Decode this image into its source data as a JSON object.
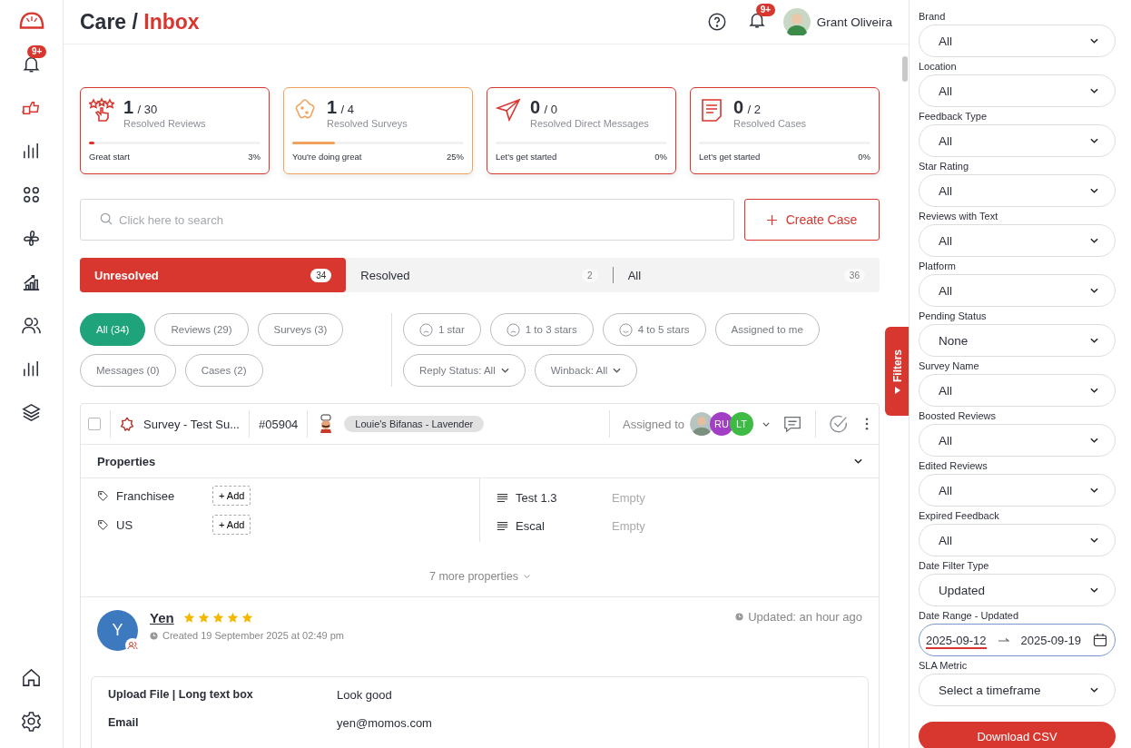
{
  "sidebar": {
    "badge": "9+",
    "items": [
      {
        "kind": "bell",
        "selected": false
      },
      {
        "kind": "feedback",
        "selected": true
      },
      {
        "kind": "chart",
        "selected": false
      },
      {
        "kind": "apps",
        "selected": false
      },
      {
        "kind": "flower",
        "selected": false
      },
      {
        "kind": "growth",
        "selected": false
      },
      {
        "kind": "people",
        "selected": false
      },
      {
        "kind": "chart",
        "selected": false
      },
      {
        "kind": "layers",
        "selected": false
      }
    ],
    "bottom_items": [
      {
        "kind": "home",
        "selected": false
      },
      {
        "kind": "settings",
        "selected": false
      }
    ]
  },
  "header": {
    "section": "Care",
    "separator": "/",
    "page": "Inbox",
    "badge": "9+",
    "user_name": "Grant Oliveira"
  },
  "stats": [
    {
      "kind": "reviews",
      "value": "1",
      "total": "/ 30",
      "label": "Resolved Reviews",
      "caption": "Great start",
      "percent": "3%",
      "level": 0.03,
      "color": "#d7372f"
    },
    {
      "kind": "surveys",
      "value": "1",
      "total": "/ 4",
      "label": "Resolved Surveys",
      "caption": "You're doing great",
      "percent": "25%",
      "level": 0.25,
      "color": "#f0a35e"
    },
    {
      "kind": "messages",
      "value": "0",
      "total": "/ 0",
      "label": "Resolved Direct Messages",
      "caption": "Let's get started",
      "percent": "0%",
      "level": 0,
      "color": "#d7372f"
    },
    {
      "kind": "cases",
      "value": "0",
      "total": "/ 2",
      "label": "Resolved Cases",
      "caption": "Let's get started",
      "percent": "0%",
      "level": 0,
      "color": "#d7372f"
    }
  ],
  "search": {
    "placeholder": "Click here to search"
  },
  "create_case": "Create Case",
  "status_tabs": [
    {
      "label": "Unresolved",
      "count": "34",
      "selected": true
    },
    {
      "label": "Resolved",
      "count": "2",
      "selected": false
    },
    {
      "label": "All",
      "count": "36",
      "selected": false
    }
  ],
  "type_filters": [
    {
      "label": "All (34)",
      "selected": true
    },
    {
      "label": "Reviews (29)",
      "selected": false
    },
    {
      "label": "Surveys (3)",
      "selected": false
    },
    {
      "label": "Messages (0)",
      "selected": false
    },
    {
      "label": "Cases (2)",
      "selected": false
    }
  ],
  "rating_filters": [
    {
      "kind": "sad",
      "label": "1 star",
      "selected": false
    },
    {
      "kind": "sad",
      "label": "1 to 3 stars",
      "selected": false
    },
    {
      "kind": "happy",
      "label": "4 to 5 stars",
      "selected": false
    },
    {
      "kind": "plain",
      "label": "Assigned to me",
      "selected": false
    },
    {
      "kind": "dropdown",
      "label": "Reply Status: All",
      "selected": false
    },
    {
      "kind": "dropdown",
      "label": "Winback: All",
      "selected": false
    }
  ],
  "item": {
    "checked": false,
    "title": "Survey - Test Su...",
    "id": "#05904",
    "location": "Louie's Bifanas - Lavender",
    "assigned_label": "Assigned to",
    "assignees": [
      {
        "kind": "photo"
      },
      {
        "kind": "initials",
        "initials": "RU",
        "color": "#a23fc4"
      },
      {
        "kind": "initials",
        "initials": "LT",
        "color": "#3dbb44"
      }
    ],
    "properties_title": "Properties",
    "tags": [
      {
        "label": "Franchisee",
        "action": "+ Add"
      },
      {
        "label": "US",
        "action": "+ Add"
      }
    ],
    "fields": [
      {
        "label": "Test 1.3",
        "value": "Empty"
      },
      {
        "label": "Escal",
        "value": "Empty"
      }
    ],
    "more": "7 more properties",
    "review": {
      "avatar": "Y",
      "name": "Yen",
      "stars": 5,
      "created": "Created 19 September 2025 at 02:49 pm",
      "updated": "Updated: an hour ago",
      "answers": [
        {
          "question": "Upload File | Long text box",
          "answer": "Look good"
        },
        {
          "question": "Email",
          "answer": "yen@momos.com"
        }
      ]
    }
  },
  "filters": {
    "tab": "Filters",
    "fields": [
      {
        "kind": "select",
        "label": "Brand",
        "value": "All"
      },
      {
        "kind": "select",
        "label": "Location",
        "value": "All"
      },
      {
        "kind": "select",
        "label": "Feedback Type",
        "value": "All"
      },
      {
        "kind": "select",
        "label": "Star Rating",
        "value": "All"
      },
      {
        "kind": "select",
        "label": "Reviews with Text",
        "value": "All"
      },
      {
        "kind": "select",
        "label": "Platform",
        "value": "All"
      },
      {
        "kind": "select",
        "label": "Pending Status",
        "value": "None"
      },
      {
        "kind": "select",
        "label": "Survey Name",
        "value": "All"
      },
      {
        "kind": "select",
        "label": "Boosted Reviews",
        "value": "All"
      },
      {
        "kind": "select",
        "label": "Edited Reviews",
        "value": "All"
      },
      {
        "kind": "select",
        "label": "Expired Feedback",
        "value": "All"
      },
      {
        "kind": "select",
        "label": "Date Filter Type",
        "value": "Updated"
      },
      {
        "kind": "daterange",
        "label": "Date Range - Updated",
        "start": "2025-09-12",
        "end": "2025-09-19"
      },
      {
        "kind": "select",
        "label": "SLA Metric",
        "value": "Select a timeframe"
      }
    ],
    "download": "Download CSV"
  }
}
